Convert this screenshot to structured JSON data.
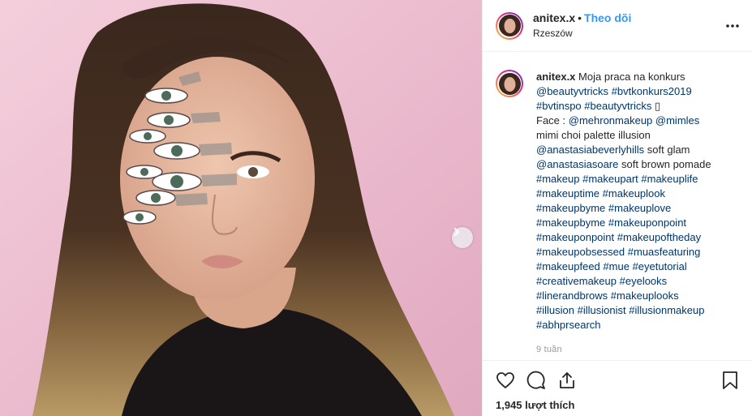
{
  "post": {
    "image_alt": "",
    "username": "anitex.x",
    "separator": "•",
    "follow_label": "Theo dõi",
    "location": "Rzeszów",
    "caption": {
      "username": "anitex.x",
      "lines": [
        [
          {
            "t": "Moja praca na konkurs",
            "link": false
          }
        ],
        [
          {
            "t": "@beautyvtricks",
            "link": true
          },
          {
            "t": " ",
            "link": false
          },
          {
            "t": "#bvtkonkurs2019",
            "link": true
          }
        ],
        [
          {
            "t": "#bvtinspo",
            "link": true
          },
          {
            "t": " ",
            "link": false
          },
          {
            "t": "#beautyvtricks",
            "link": true
          },
          {
            "t": " ▯",
            "link": false
          }
        ],
        [
          {
            "t": "Face : ",
            "link": false
          },
          {
            "t": "@mehronmakeup",
            "link": true
          },
          {
            "t": " ",
            "link": false
          },
          {
            "t": "@mimles",
            "link": true
          }
        ],
        [
          {
            "t": "mimi choi palette illusion",
            "link": false
          }
        ],
        [
          {
            "t": "@anastasiabeverlyhills",
            "link": true
          },
          {
            "t": " soft glam",
            "link": false
          }
        ],
        [
          {
            "t": "@anastasiasoare",
            "link": true
          },
          {
            "t": " soft brown pomade",
            "link": false
          }
        ],
        [
          {
            "t": "#makeup",
            "link": true
          },
          {
            "t": " ",
            "link": false
          },
          {
            "t": "#makeupart",
            "link": true
          },
          {
            "t": " ",
            "link": false
          },
          {
            "t": "#makeuplife",
            "link": true
          }
        ],
        [
          {
            "t": "#makeuptime",
            "link": true
          },
          {
            "t": " ",
            "link": false
          },
          {
            "t": "#makeuplook",
            "link": true
          }
        ],
        [
          {
            "t": "#makeupbyme",
            "link": true
          },
          {
            "t": " ",
            "link": false
          },
          {
            "t": "#makeuplove",
            "link": true
          }
        ],
        [
          {
            "t": "#makeupbyme",
            "link": true
          },
          {
            "t": " ",
            "link": false
          },
          {
            "t": "#makeuponpoint",
            "link": true
          }
        ],
        [
          {
            "t": "#makeuponpoint",
            "link": true
          },
          {
            "t": " ",
            "link": false
          },
          {
            "t": "#makeupoftheday",
            "link": true
          }
        ],
        [
          {
            "t": "#makeupobsessed",
            "link": true
          },
          {
            "t": " ",
            "link": false
          },
          {
            "t": "#muasfeaturing",
            "link": true
          }
        ],
        [
          {
            "t": "#makeupfeed",
            "link": true
          },
          {
            "t": " ",
            "link": false
          },
          {
            "t": "#mue",
            "link": true
          },
          {
            "t": " ",
            "link": false
          },
          {
            "t": "#eyetutorial",
            "link": true
          }
        ],
        [
          {
            "t": "#creativemakeup",
            "link": true
          },
          {
            "t": " ",
            "link": false
          },
          {
            "t": "#eyelooks",
            "link": true
          }
        ],
        [
          {
            "t": "#linerandbrows",
            "link": true
          },
          {
            "t": " ",
            "link": false
          },
          {
            "t": "#makeuplooks",
            "link": true
          }
        ],
        [
          {
            "t": "#illusion",
            "link": true
          },
          {
            "t": " ",
            "link": false
          },
          {
            "t": "#illusionist",
            "link": true
          },
          {
            "t": " ",
            "link": false
          },
          {
            "t": "#illusionmakeup",
            "link": true
          }
        ],
        [
          {
            "t": "#abhprsearch",
            "link": true
          }
        ]
      ]
    },
    "time_ago": "9 tuần",
    "likes": "1,945 lượt thích",
    "icons": {
      "more": "more-options-icon",
      "like": "heart-icon",
      "comment": "comment-icon",
      "share": "share-icon",
      "save": "bookmark-icon",
      "next": "chevron-right-icon"
    },
    "colors": {
      "follow": "#3897f0",
      "link": "#003569",
      "muted": "#999999"
    }
  }
}
